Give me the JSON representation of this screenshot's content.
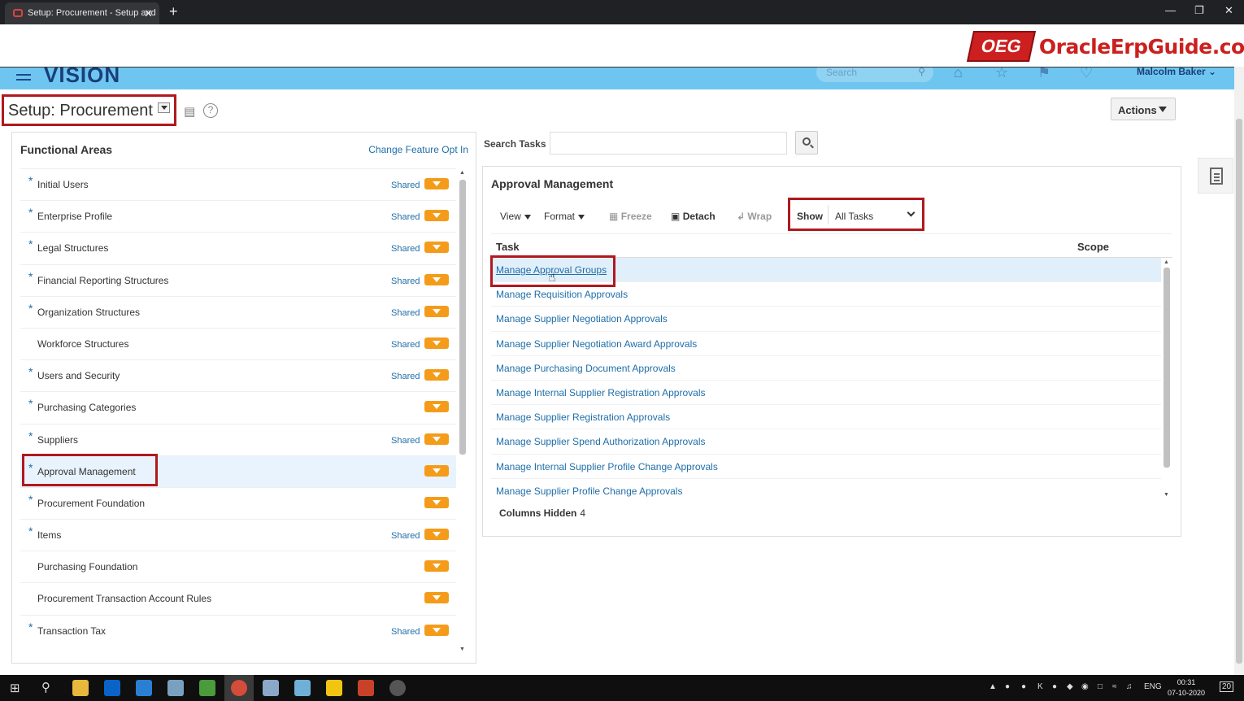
{
  "browser": {
    "tab_title": "Setup: Procurement - Setup and",
    "tab_close": "✕",
    "new_tab": "+"
  },
  "branding": {
    "logo_text": "OEG",
    "site_name": "OracleErpGuide.com"
  },
  "header": {
    "app_name": "VISION",
    "search_placeholder": "Search",
    "user_name": "Malcolm Baker"
  },
  "page": {
    "title": "Setup: Procurement",
    "actions_label": "Actions"
  },
  "functional_areas": {
    "heading": "Functional Areas",
    "change_feature_link": "Change Feature Opt In",
    "items": [
      {
        "label": "Initial Users",
        "required": true,
        "shared": "Shared"
      },
      {
        "label": "Enterprise Profile",
        "required": true,
        "shared": "Shared"
      },
      {
        "label": "Legal Structures",
        "required": true,
        "shared": "Shared"
      },
      {
        "label": "Financial Reporting Structures",
        "required": true,
        "shared": "Shared"
      },
      {
        "label": "Organization Structures",
        "required": true,
        "shared": "Shared"
      },
      {
        "label": "Workforce Structures",
        "required": false,
        "shared": "Shared"
      },
      {
        "label": "Users and Security",
        "required": true,
        "shared": "Shared"
      },
      {
        "label": "Purchasing Categories",
        "required": true,
        "shared": ""
      },
      {
        "label": "Suppliers",
        "required": true,
        "shared": "Shared"
      },
      {
        "label": "Approval Management",
        "required": true,
        "shared": "",
        "selected": true
      },
      {
        "label": "Procurement Foundation",
        "required": true,
        "shared": ""
      },
      {
        "label": "Items",
        "required": true,
        "shared": "Shared"
      },
      {
        "label": "Purchasing Foundation",
        "required": false,
        "shared": ""
      },
      {
        "label": "Procurement Transaction Account Rules",
        "required": false,
        "shared": ""
      },
      {
        "label": "Transaction Tax",
        "required": true,
        "shared": "Shared"
      }
    ]
  },
  "search_tasks": {
    "label": "Search Tasks",
    "value": ""
  },
  "approval_management": {
    "heading": "Approval Management",
    "toolbar": {
      "view": "View",
      "format": "Format",
      "freeze": "Freeze",
      "detach": "Detach",
      "wrap": "Wrap",
      "show_label": "Show",
      "show_value": "All Tasks"
    },
    "columns": {
      "task": "Task",
      "scope": "Scope"
    },
    "tasks": [
      "Manage Approval Groups",
      "Manage Requisition Approvals",
      "Manage Supplier Negotiation Approvals",
      "Manage Supplier Negotiation Award Approvals",
      "Manage Purchasing Document Approvals",
      "Manage Internal Supplier Registration Approvals",
      "Manage Supplier Registration Approvals",
      "Manage Supplier Spend Authorization Approvals",
      "Manage Internal Supplier Profile Change Approvals",
      "Manage Supplier Profile Change Approvals"
    ],
    "columns_hidden_label": "Columns Hidden",
    "columns_hidden_value": "4"
  },
  "taskbar": {
    "lang": "ENG",
    "time": "00:31",
    "date": "07-10-2020",
    "notifications": "20"
  },
  "colors": {
    "header_blue": "#6ec6f0",
    "link_blue": "#1f6ea8",
    "highlight_red": "#b0191e",
    "badge_orange": "#f59b1a"
  }
}
